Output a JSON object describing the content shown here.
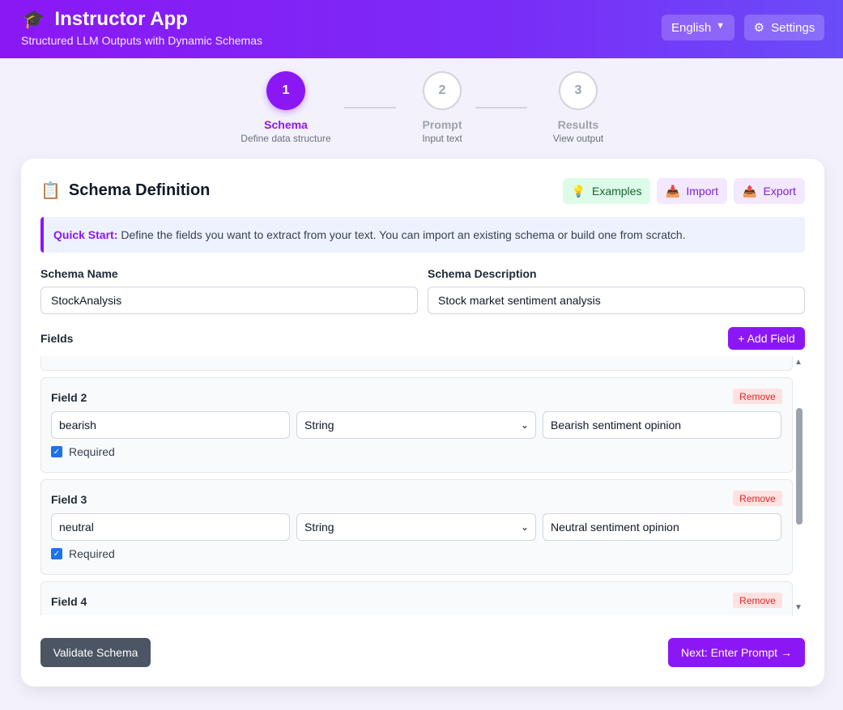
{
  "header": {
    "logo_icon": "🎓",
    "title": "Instructor App",
    "subtitle": "Structured LLM Outputs with Dynamic Schemas",
    "language": "English",
    "settings_label": "Settings",
    "gradient_start": "#8b17f5",
    "gradient_end": "#6a4cf8"
  },
  "steps": [
    {
      "number": "1",
      "label": "Schema",
      "sub": "Define data structure",
      "state": "active"
    },
    {
      "number": "2",
      "label": "Prompt",
      "sub": "Input text",
      "state": "inactive"
    },
    {
      "number": "3",
      "label": "Results",
      "sub": "View output",
      "state": "inactive"
    }
  ],
  "card": {
    "title_icon": "📋",
    "title": "Schema Definition",
    "examples_icon": "💡",
    "examples_label": "Examples",
    "import_icon": "📥",
    "import_label": "Import",
    "export_icon": "📤",
    "export_label": "Export",
    "quick_start_label": "Quick Start:",
    "quick_start_text": "Define the fields you want to extract from your text. You can import an existing schema or build one from scratch.",
    "schema_name_label": "Schema Name",
    "schema_name_value": "StockAnalysis",
    "schema_desc_label": "Schema Description",
    "schema_desc_value": "Stock market sentiment analysis",
    "fields_label": "Fields",
    "add_field_label": "+ Add Field",
    "remove_label": "Remove",
    "required_label": "Required",
    "fields": [
      {
        "title": "Field 2",
        "name": "bearish",
        "type": "String",
        "description": "Bearish sentiment opinion",
        "required": true
      },
      {
        "title": "Field 3",
        "name": "neutral",
        "type": "String",
        "description": "Neutral sentiment opinion",
        "required": true
      },
      {
        "title": "Field 4",
        "name": "",
        "type": "",
        "description": "",
        "required": true
      }
    ],
    "validate_label": "Validate Schema",
    "next_label": "Next: Enter Prompt →"
  },
  "colors": {
    "accent": "#8b17f5",
    "validate_bg": "#4b5563",
    "remove_bg": "#fee2e2",
    "remove_text": "#dc2626"
  }
}
